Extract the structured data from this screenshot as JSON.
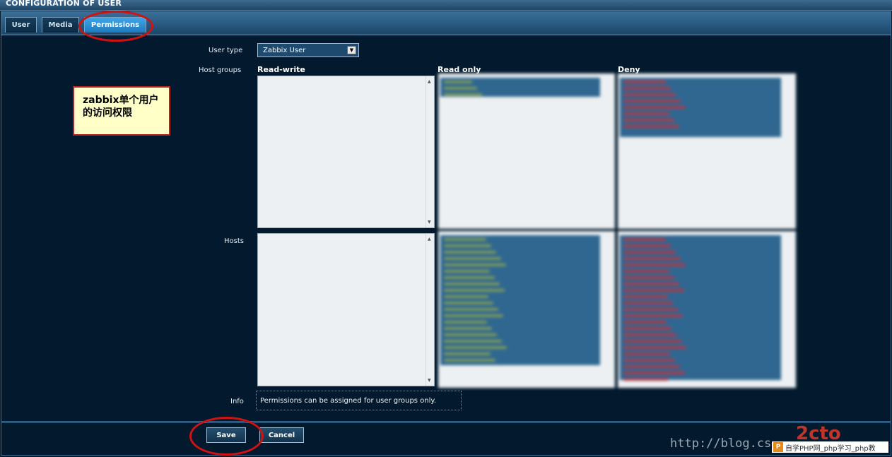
{
  "window": {
    "title": "CONFIGURATION OF USER"
  },
  "tabs": [
    {
      "label": "User",
      "active": false
    },
    {
      "label": "Media",
      "active": false
    },
    {
      "label": "Permissions",
      "active": true
    }
  ],
  "form": {
    "user_type_label": "User type",
    "user_type_value": "Zabbix User",
    "host_groups_label": "Host groups",
    "hosts_label": "Hosts",
    "info_label": "Info",
    "info_text": "Permissions can be assigned for user groups only."
  },
  "columns": {
    "read_write": "Read-write",
    "read_only": "Read only",
    "deny": "Deny"
  },
  "buttons": {
    "save": "Save",
    "cancel": "Cancel"
  },
  "annotation": {
    "note": "zabbix单个用户的访问权限"
  },
  "watermark": {
    "url": "http://blog.cs",
    "brand": "自学PHP网_php学习_php教"
  },
  "colors": {
    "panel": "#031a2e",
    "tab_active": "#2f8fd4",
    "selection": "#2f6791",
    "annotation_ring": "#d01212"
  },
  "icons": {
    "dropdown": "chevron-down-icon",
    "scroll_up": "scroll-up-icon",
    "scroll_down": "scroll-down-icon"
  }
}
